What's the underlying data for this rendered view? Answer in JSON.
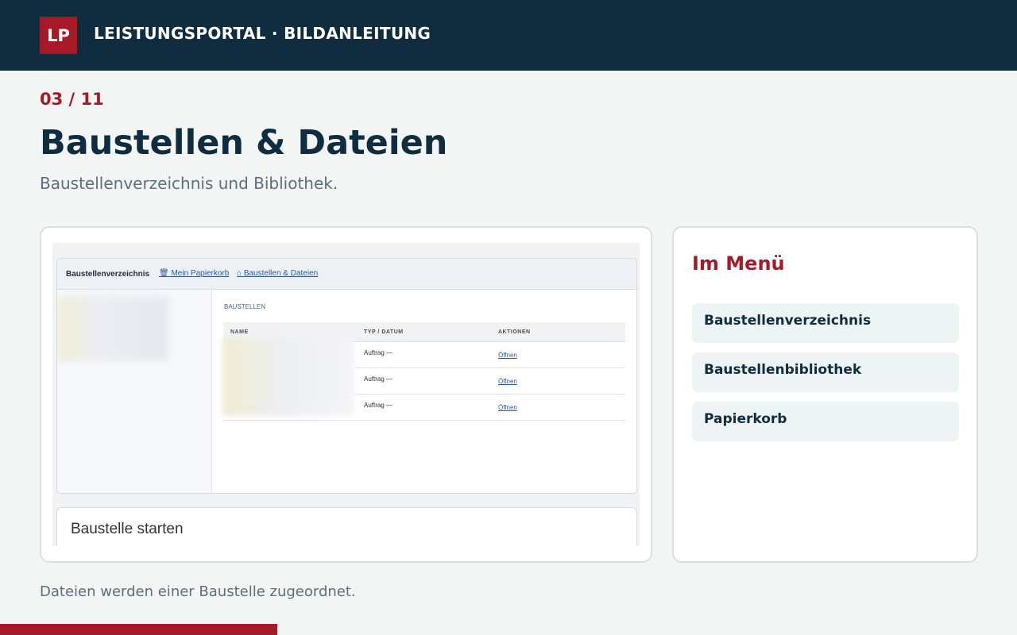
{
  "header": {
    "logo": "LP",
    "title": "LEISTUNGSPORTAL · BILDANLEITUNG"
  },
  "step": "03 / 11",
  "title": "Baustellen & Dateien",
  "subtitle": "Baustellenverzeichnis und Bibliothek.",
  "screenshot": {
    "window_title": "Baustellenverzeichnis",
    "links": [
      "🗑 Mein Papierkorb",
      "⌂ Baustellen & Dateien"
    ],
    "section": "BAUSTELLEN",
    "columns": [
      "NAME",
      "TYP / DATUM",
      "AKTIONEN"
    ],
    "rows": [
      {
        "typ": "Auftrag —",
        "action": "Öffnen"
      },
      {
        "typ": "Auftrag —",
        "action": "Öffnen"
      },
      {
        "typ": "Auftrag —",
        "action": "Öffnen"
      }
    ],
    "start_card_title": "Baustelle starten"
  },
  "menu": {
    "title": "Im Menü",
    "items": [
      "Baustellenverzeichnis",
      "Baustellenbibliothek",
      "Papierkorb"
    ]
  },
  "caption": "Dateien werden einer Baustelle zugeordnet.",
  "progress": {
    "current": 3,
    "total": 11
  },
  "colors": {
    "navy": "#102d40",
    "accent": "#a61a27"
  }
}
